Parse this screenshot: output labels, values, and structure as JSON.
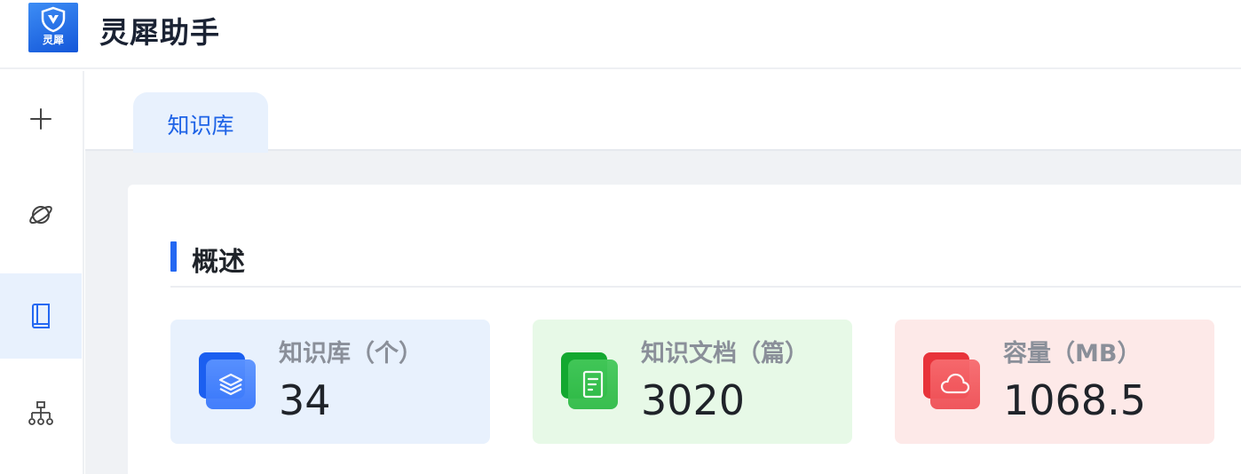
{
  "app": {
    "logo_text": "灵犀",
    "title": "灵犀助手"
  },
  "sidebar": {
    "items": [
      {
        "icon": "plus-icon",
        "active": false
      },
      {
        "icon": "planet-icon",
        "active": false
      },
      {
        "icon": "book-icon",
        "active": true
      },
      {
        "icon": "sitemap-icon",
        "active": false
      }
    ]
  },
  "tabs": [
    {
      "label": "知识库",
      "active": true
    }
  ],
  "overview": {
    "title": "概述",
    "cards": [
      {
        "label": "知识库（个）",
        "value": "34",
        "icon": "layers-icon",
        "color": "#1b5ff0"
      },
      {
        "label": "知识文档（篇）",
        "value": "3020",
        "icon": "document-icon",
        "color": "#13a830"
      },
      {
        "label": "容量（MB）",
        "value": "1068.5",
        "icon": "cloud-icon",
        "color": "#e8333a"
      }
    ]
  },
  "colors": {
    "accent": "#2468f2",
    "active_bg": "#e8f1fd"
  }
}
